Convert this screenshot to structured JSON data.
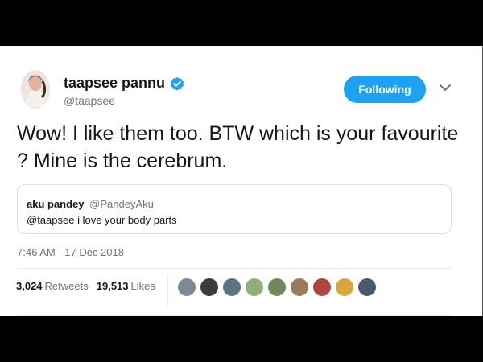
{
  "tweet": {
    "author_name": "taapsee pannu",
    "author_handle": "@taapsee",
    "follow_label": "Following",
    "text": "Wow! I like them too. BTW which is your favourite ? Mine is the cerebrum.",
    "timestamp": "7:46 AM - 17 Dec 2018",
    "quoted": {
      "name": "aku pandey",
      "handle": "@PandeyAku",
      "text": "@taapsee i love your body parts"
    },
    "stats": {
      "retweets_count": "3,024",
      "retweets_label": "Retweets",
      "likes_count": "19,513",
      "likes_label": "Likes"
    }
  },
  "icons": {
    "verified": "verified-badge-icon",
    "caret": "chevron-down-icon"
  },
  "colors": {
    "accent": "#1da1f2",
    "text": "#14171a",
    "muted": "#657786"
  },
  "likers": [
    {
      "color": "#7a8a99"
    },
    {
      "color": "#3c3a3c"
    },
    {
      "color": "#5c7480"
    },
    {
      "color": "#8fae7a"
    },
    {
      "color": "#6f8a5a"
    },
    {
      "color": "#9a7b5a"
    },
    {
      "color": "#b3463a"
    },
    {
      "color": "#d9a63a"
    },
    {
      "color": "#4a5a6a"
    }
  ]
}
